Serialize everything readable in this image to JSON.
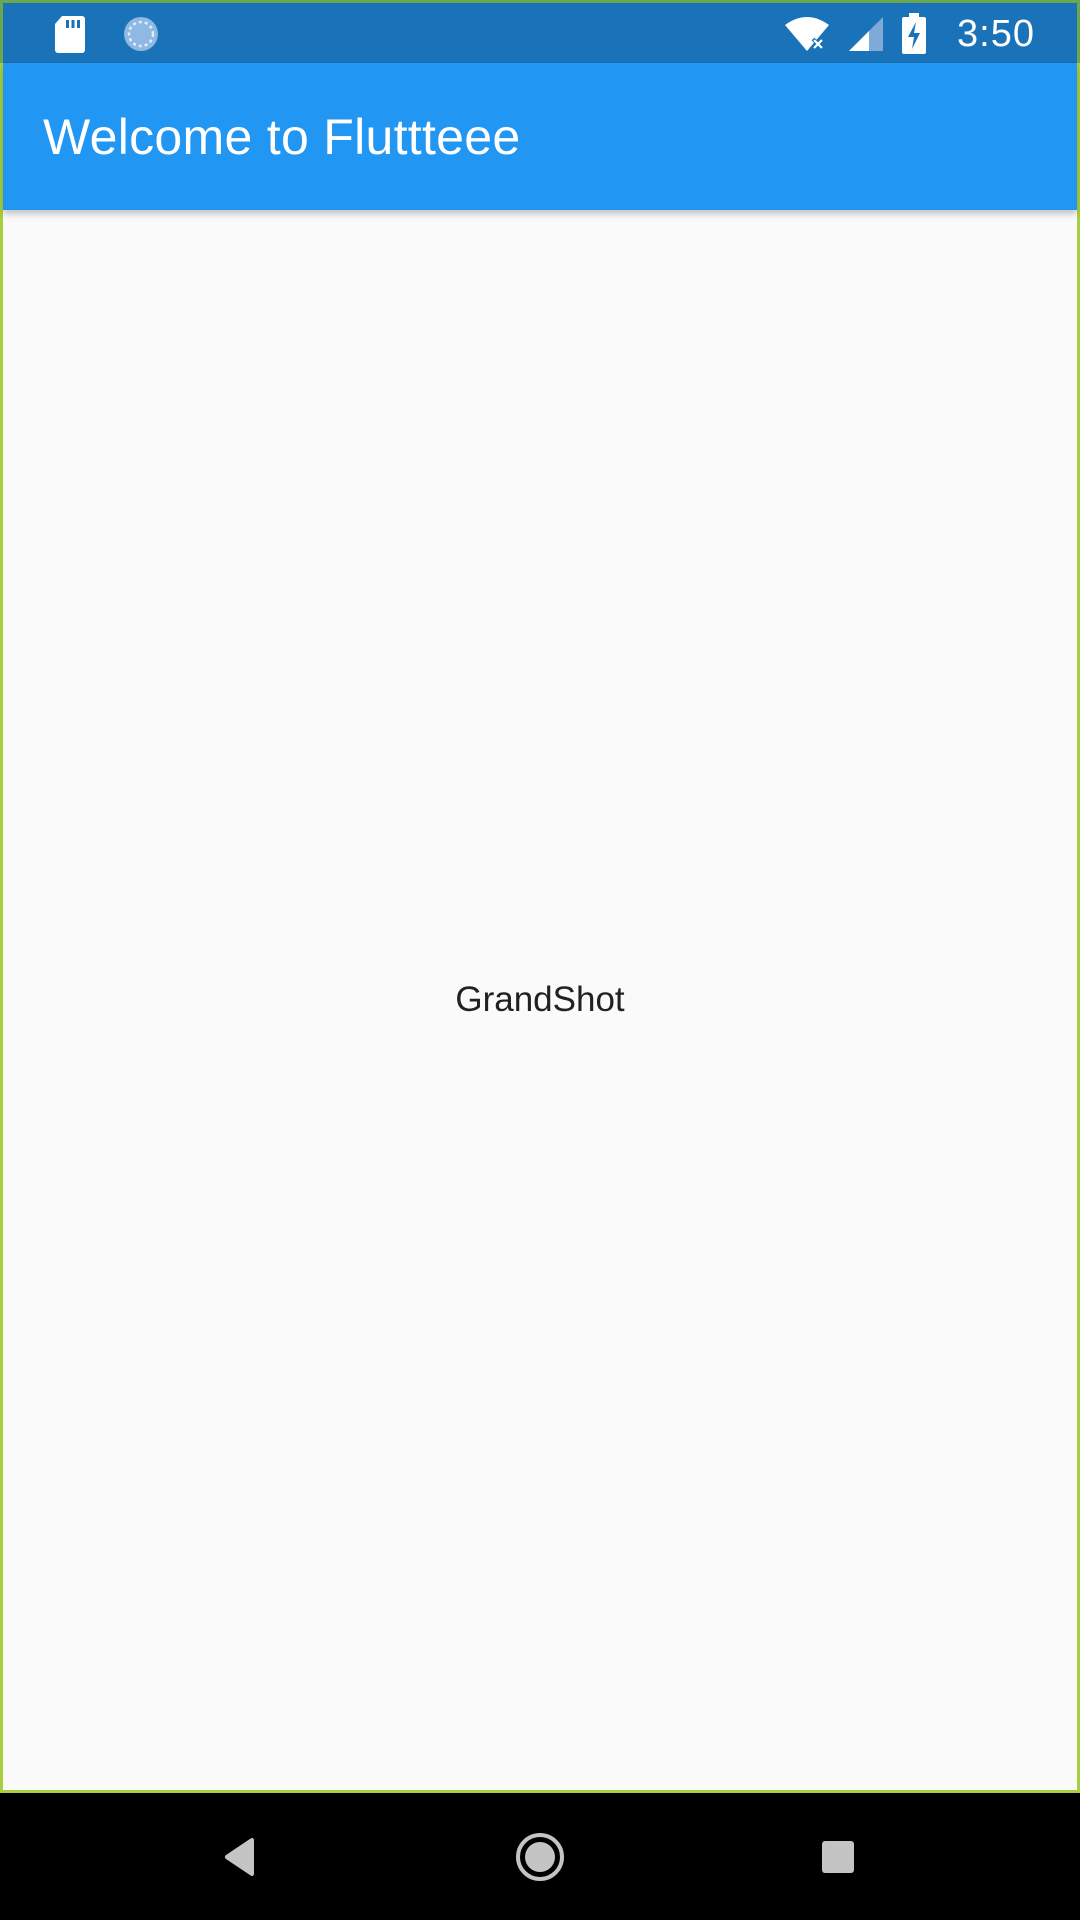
{
  "status_bar": {
    "time": "3:50",
    "left_icons": [
      "sd-card-icon",
      "sync-icon"
    ],
    "right_icons": [
      "wifi-off-icon",
      "cell-signal-icon",
      "battery-charging-icon"
    ],
    "background": "#1A72B8"
  },
  "app_bar": {
    "title": "Welcome to Fluttteee",
    "background": "#2196F3"
  },
  "body": {
    "text": "GrandShot",
    "background": "#FAFAFA"
  },
  "nav_bar": {
    "buttons": [
      "back-icon",
      "home-icon",
      "recents-icon"
    ],
    "background": "#000000"
  }
}
